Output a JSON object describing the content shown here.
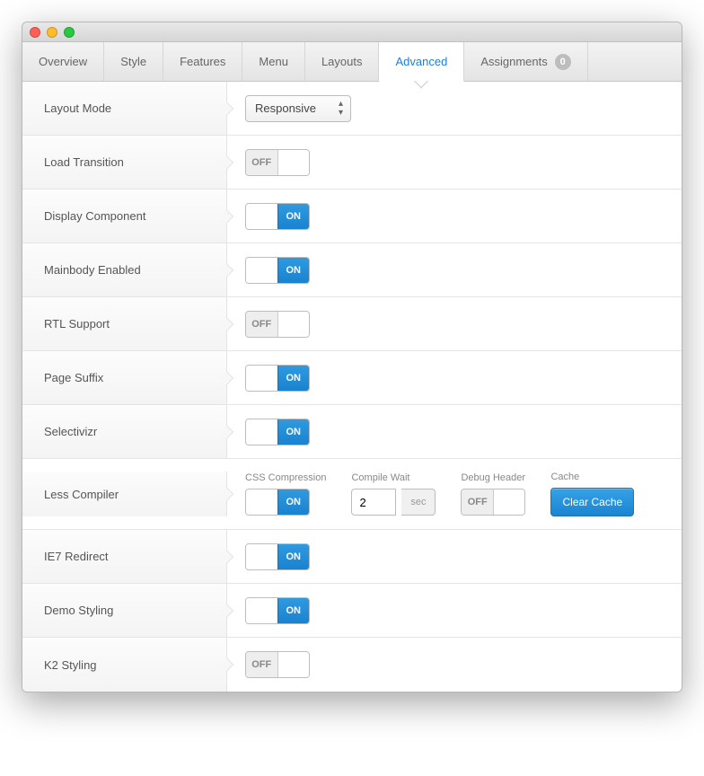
{
  "tabs": {
    "items": [
      {
        "label": "Overview",
        "active": false
      },
      {
        "label": "Style",
        "active": false
      },
      {
        "label": "Features",
        "active": false
      },
      {
        "label": "Menu",
        "active": false
      },
      {
        "label": "Layouts",
        "active": false
      },
      {
        "label": "Advanced",
        "active": true
      },
      {
        "label": "Assignments",
        "active": false,
        "badge": "0"
      }
    ]
  },
  "rows": {
    "layout_mode": {
      "label": "Layout Mode",
      "select_value": "Responsive"
    },
    "load_transition": {
      "label": "Load Transition",
      "toggle": "OFF"
    },
    "display_component": {
      "label": "Display Component",
      "toggle": "ON"
    },
    "mainbody_enabled": {
      "label": "Mainbody Enabled",
      "toggle": "ON"
    },
    "rtl_support": {
      "label": "RTL Support",
      "toggle": "OFF"
    },
    "page_suffix": {
      "label": "Page Suffix",
      "toggle": "ON"
    },
    "selectivizr": {
      "label": "Selectivizr",
      "toggle": "ON"
    },
    "less_compiler": {
      "label": "Less Compiler",
      "css_compression": {
        "label": "CSS Compression",
        "toggle": "ON"
      },
      "compile_wait": {
        "label": "Compile Wait",
        "value": "2",
        "suffix": "sec"
      },
      "debug_header": {
        "label": "Debug Header",
        "toggle": "OFF"
      },
      "cache": {
        "label": "Cache",
        "button": "Clear Cache"
      }
    },
    "ie7_redirect": {
      "label": "IE7 Redirect",
      "toggle": "ON"
    },
    "demo_styling": {
      "label": "Demo Styling",
      "toggle": "ON"
    },
    "k2_styling": {
      "label": "K2 Styling",
      "toggle": "OFF"
    }
  },
  "toggle_texts": {
    "on": "ON",
    "off": "OFF"
  }
}
